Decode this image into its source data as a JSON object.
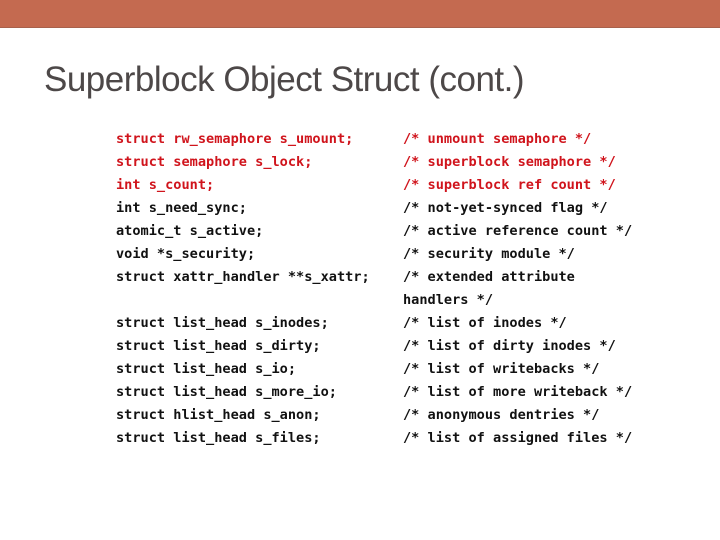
{
  "slide": {
    "title": "Superblock Object Struct (cont.)",
    "accent_color": "#c46a50",
    "highlight_color": "#d0141c",
    "code_rows": [
      {
        "decl": "struct rw_semaphore s_umount;",
        "comment": "/* unmount semaphore */",
        "highlighted": true
      },
      {
        "decl": "struct semaphore s_lock;",
        "comment": "/* superblock semaphore */",
        "highlighted": true
      },
      {
        "decl": "int s_count;",
        "comment": "/* superblock ref count */",
        "highlighted": true
      },
      {
        "decl": "int s_need_sync;",
        "comment": "/* not-yet-synced flag */",
        "highlighted": false
      },
      {
        "decl": "atomic_t s_active;",
        "comment": "/* active reference count */",
        "highlighted": false
      },
      {
        "decl": "void *s_security;",
        "comment": "/* security module */",
        "highlighted": false
      },
      {
        "decl": "struct xattr_handler **s_xattr;",
        "comment": "/* extended attribute",
        "highlighted": false
      },
      {
        "decl": "",
        "comment": "handlers */",
        "highlighted": false,
        "continuation": true
      },
      {
        "decl": "struct list_head s_inodes;",
        "comment": "/* list of inodes */",
        "highlighted": false
      },
      {
        "decl": "struct list_head s_dirty;",
        "comment": "/* list of dirty inodes */",
        "highlighted": false
      },
      {
        "decl": "struct list_head s_io;",
        "comment": "/* list of writebacks */",
        "highlighted": false
      },
      {
        "decl": "struct list_head s_more_io;",
        "comment": "/* list of more writeback */",
        "highlighted": false
      },
      {
        "decl": "struct hlist_head s_anon;",
        "comment": "/* anonymous dentries */",
        "highlighted": false
      },
      {
        "decl": "struct list_head s_files;",
        "comment": "/* list of assigned files */",
        "highlighted": false
      }
    ]
  }
}
